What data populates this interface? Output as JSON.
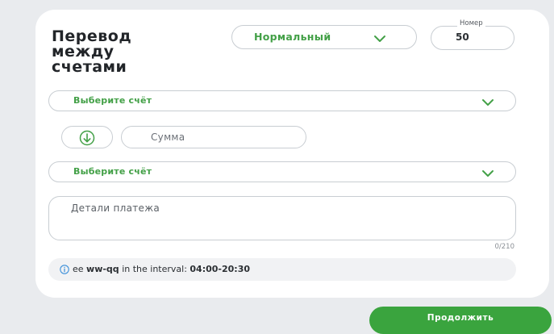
{
  "form": {
    "title": "Перевод\nмежду\nсчетами",
    "priority": {
      "selected": "Нормальный"
    },
    "number": {
      "label": "Номер",
      "value": "50"
    },
    "from_account": {
      "placeholder": "Выберите счёт"
    },
    "amount": {
      "placeholder": "Сумма"
    },
    "to_account": {
      "placeholder": "Выберите счёт"
    },
    "details": {
      "placeholder": "Детали платежа",
      "counter": "0/210"
    },
    "info": {
      "text_prefix": "ee",
      "text_bold": "ww-qq",
      "text_middle": "in the interval:",
      "text_time": "04:00-20:30"
    }
  },
  "actions": {
    "continue_label": "Продолжить"
  },
  "colors": {
    "accent": "#43a047",
    "button": "#3aa43e",
    "info_icon": "#3b8fd9"
  },
  "icons": {
    "dropdown": "chevron-down-icon",
    "swap": "arrow-down-circle-icon",
    "info": "info-icon"
  }
}
